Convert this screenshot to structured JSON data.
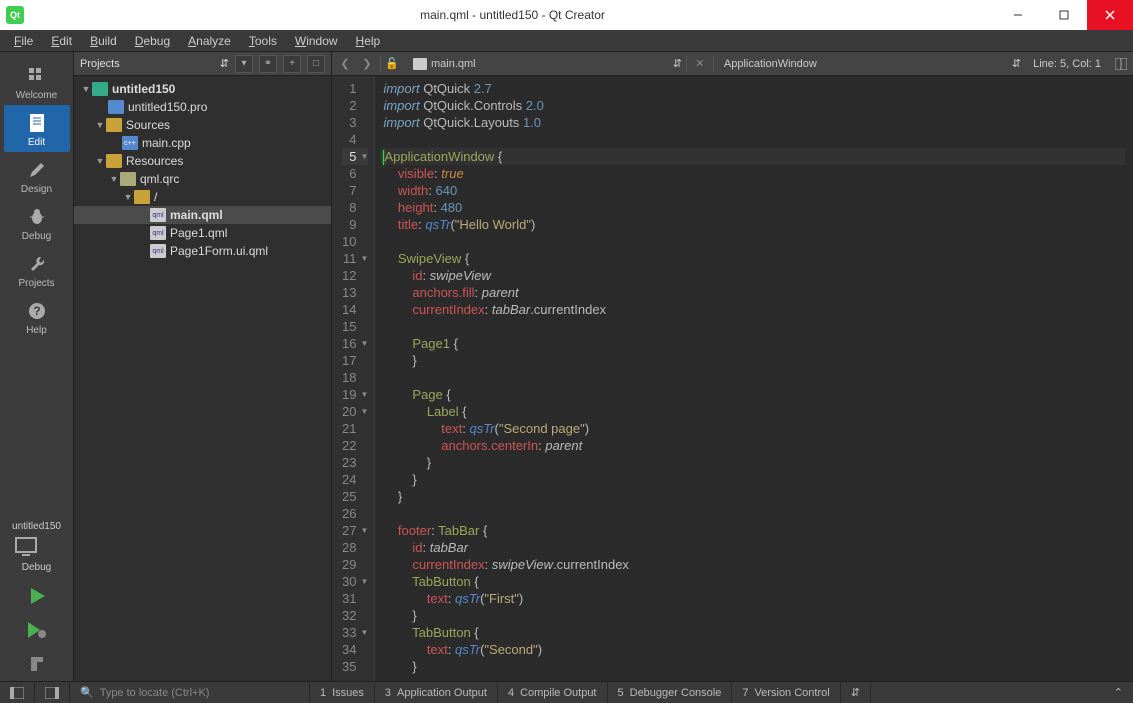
{
  "window": {
    "title": "main.qml - untitled150 - Qt Creator"
  },
  "menu": {
    "file": "File",
    "edit": "Edit",
    "build": "Build",
    "debug": "Debug",
    "analyze": "Analyze",
    "tools": "Tools",
    "window": "Window",
    "help": "Help"
  },
  "modes": {
    "welcome": "Welcome",
    "edit": "Edit",
    "design": "Design",
    "debug": "Debug",
    "projects": "Projects",
    "help": "Help",
    "kit": "untitled150",
    "kitmode": "Debug"
  },
  "projpanel": {
    "selector": "Projects",
    "tree": {
      "root": "untitled150",
      "profile": "untitled150.pro",
      "sources": "Sources",
      "maincpp": "main.cpp",
      "resources": "Resources",
      "qrc": "qml.qrc",
      "slash": "/",
      "mainqml": "main.qml",
      "page1": "Page1.qml",
      "page1form": "Page1Form.ui.qml"
    }
  },
  "editorbar": {
    "filename": "main.qml",
    "breadcrumb": "ApplicationWindow",
    "position": "Line: 5, Col: 1"
  },
  "code": [
    {
      "n": 1,
      "t": [
        [
          "kw-imp",
          "import"
        ],
        [
          "kw-plain",
          " QtQuick "
        ],
        [
          "kw-num",
          "2.7"
        ]
      ]
    },
    {
      "n": 2,
      "t": [
        [
          "kw-imp",
          "import"
        ],
        [
          "kw-plain",
          " QtQuick.Controls "
        ],
        [
          "kw-num",
          "2.0"
        ]
      ]
    },
    {
      "n": 3,
      "t": [
        [
          "kw-imp",
          "import"
        ],
        [
          "kw-plain",
          " QtQuick.Layouts "
        ],
        [
          "kw-num",
          "1.0"
        ]
      ]
    },
    {
      "n": 4,
      "t": []
    },
    {
      "n": 5,
      "fold": true,
      "curr": true,
      "t": [
        [
          "kw-type",
          "ApplicationWindow"
        ],
        [
          "kw-plain",
          " {"
        ]
      ]
    },
    {
      "n": 6,
      "t": [
        [
          "kw-plain",
          "    "
        ],
        [
          "kw-prop",
          "visible"
        ],
        [
          "kw-plain",
          ": "
        ],
        [
          "kw-val",
          "true"
        ]
      ]
    },
    {
      "n": 7,
      "t": [
        [
          "kw-plain",
          "    "
        ],
        [
          "kw-prop",
          "width"
        ],
        [
          "kw-plain",
          ": "
        ],
        [
          "kw-num",
          "640"
        ]
      ]
    },
    {
      "n": 8,
      "t": [
        [
          "kw-plain",
          "    "
        ],
        [
          "kw-prop",
          "height"
        ],
        [
          "kw-plain",
          ": "
        ],
        [
          "kw-num",
          "480"
        ]
      ]
    },
    {
      "n": 9,
      "t": [
        [
          "kw-plain",
          "    "
        ],
        [
          "kw-prop",
          "title"
        ],
        [
          "kw-plain",
          ": "
        ],
        [
          "kw-func",
          "qsTr"
        ],
        [
          "kw-plain",
          "("
        ],
        [
          "kw-str",
          "\"Hello World\""
        ],
        [
          "kw-plain",
          ")"
        ]
      ]
    },
    {
      "n": 10,
      "t": []
    },
    {
      "n": 11,
      "fold": true,
      "t": [
        [
          "kw-plain",
          "    "
        ],
        [
          "kw-type",
          "SwipeView"
        ],
        [
          "kw-plain",
          " {"
        ]
      ]
    },
    {
      "n": 12,
      "t": [
        [
          "kw-plain",
          "        "
        ],
        [
          "kw-prop",
          "id"
        ],
        [
          "kw-plain",
          ": "
        ],
        [
          "kw-ref",
          "swipeView"
        ]
      ]
    },
    {
      "n": 13,
      "t": [
        [
          "kw-plain",
          "        "
        ],
        [
          "kw-prop",
          "anchors.fill"
        ],
        [
          "kw-plain",
          ": "
        ],
        [
          "kw-ref",
          "parent"
        ]
      ]
    },
    {
      "n": 14,
      "t": [
        [
          "kw-plain",
          "        "
        ],
        [
          "kw-prop",
          "currentIndex"
        ],
        [
          "kw-plain",
          ": "
        ],
        [
          "kw-ref",
          "tabBar"
        ],
        [
          "kw-plain",
          ".currentIndex"
        ]
      ]
    },
    {
      "n": 15,
      "t": []
    },
    {
      "n": 16,
      "fold": true,
      "t": [
        [
          "kw-plain",
          "        "
        ],
        [
          "kw-type",
          "Page1"
        ],
        [
          "kw-plain",
          " {"
        ]
      ]
    },
    {
      "n": 17,
      "t": [
        [
          "kw-plain",
          "        }"
        ]
      ]
    },
    {
      "n": 18,
      "t": []
    },
    {
      "n": 19,
      "fold": true,
      "t": [
        [
          "kw-plain",
          "        "
        ],
        [
          "kw-type",
          "Page"
        ],
        [
          "kw-plain",
          " {"
        ]
      ]
    },
    {
      "n": 20,
      "fold": true,
      "t": [
        [
          "kw-plain",
          "            "
        ],
        [
          "kw-type",
          "Label"
        ],
        [
          "kw-plain",
          " {"
        ]
      ]
    },
    {
      "n": 21,
      "t": [
        [
          "kw-plain",
          "                "
        ],
        [
          "kw-prop",
          "text"
        ],
        [
          "kw-plain",
          ": "
        ],
        [
          "kw-func",
          "qsTr"
        ],
        [
          "kw-plain",
          "("
        ],
        [
          "kw-str",
          "\"Second page\""
        ],
        [
          "kw-plain",
          ")"
        ]
      ]
    },
    {
      "n": 22,
      "t": [
        [
          "kw-plain",
          "                "
        ],
        [
          "kw-prop",
          "anchors.centerIn"
        ],
        [
          "kw-plain",
          ": "
        ],
        [
          "kw-ref",
          "parent"
        ]
      ]
    },
    {
      "n": 23,
      "t": [
        [
          "kw-plain",
          "            }"
        ]
      ]
    },
    {
      "n": 24,
      "t": [
        [
          "kw-plain",
          "        }"
        ]
      ]
    },
    {
      "n": 25,
      "t": [
        [
          "kw-plain",
          "    }"
        ]
      ]
    },
    {
      "n": 26,
      "t": []
    },
    {
      "n": 27,
      "fold": true,
      "t": [
        [
          "kw-plain",
          "    "
        ],
        [
          "kw-prop",
          "footer"
        ],
        [
          "kw-plain",
          ": "
        ],
        [
          "kw-type",
          "TabBar"
        ],
        [
          "kw-plain",
          " {"
        ]
      ]
    },
    {
      "n": 28,
      "t": [
        [
          "kw-plain",
          "        "
        ],
        [
          "kw-prop",
          "id"
        ],
        [
          "kw-plain",
          ": "
        ],
        [
          "kw-ref",
          "tabBar"
        ]
      ]
    },
    {
      "n": 29,
      "t": [
        [
          "kw-plain",
          "        "
        ],
        [
          "kw-prop",
          "currentIndex"
        ],
        [
          "kw-plain",
          ": "
        ],
        [
          "kw-ref",
          "swipeView"
        ],
        [
          "kw-plain",
          ".currentIndex"
        ]
      ]
    },
    {
      "n": 30,
      "fold": true,
      "t": [
        [
          "kw-plain",
          "        "
        ],
        [
          "kw-type",
          "TabButton"
        ],
        [
          "kw-plain",
          " {"
        ]
      ]
    },
    {
      "n": 31,
      "t": [
        [
          "kw-plain",
          "            "
        ],
        [
          "kw-prop",
          "text"
        ],
        [
          "kw-plain",
          ": "
        ],
        [
          "kw-func",
          "qsTr"
        ],
        [
          "kw-plain",
          "("
        ],
        [
          "kw-str",
          "\"First\""
        ],
        [
          "kw-plain",
          ")"
        ]
      ]
    },
    {
      "n": 32,
      "t": [
        [
          "kw-plain",
          "        }"
        ]
      ]
    },
    {
      "n": 33,
      "fold": true,
      "t": [
        [
          "kw-plain",
          "        "
        ],
        [
          "kw-type",
          "TabButton"
        ],
        [
          "kw-plain",
          " {"
        ]
      ]
    },
    {
      "n": 34,
      "t": [
        [
          "kw-plain",
          "            "
        ],
        [
          "kw-prop",
          "text"
        ],
        [
          "kw-plain",
          ": "
        ],
        [
          "kw-func",
          "qsTr"
        ],
        [
          "kw-plain",
          "("
        ],
        [
          "kw-str",
          "\"Second\""
        ],
        [
          "kw-plain",
          ")"
        ]
      ]
    },
    {
      "n": 35,
      "t": [
        [
          "kw-plain",
          "        }"
        ]
      ]
    }
  ],
  "status": {
    "locate": "Type to locate (Ctrl+K)",
    "panes": [
      {
        "n": "1",
        "l": "Issues"
      },
      {
        "n": "3",
        "l": "Application Output"
      },
      {
        "n": "4",
        "l": "Compile Output"
      },
      {
        "n": "5",
        "l": "Debugger Console"
      },
      {
        "n": "7",
        "l": "Version Control"
      }
    ]
  }
}
